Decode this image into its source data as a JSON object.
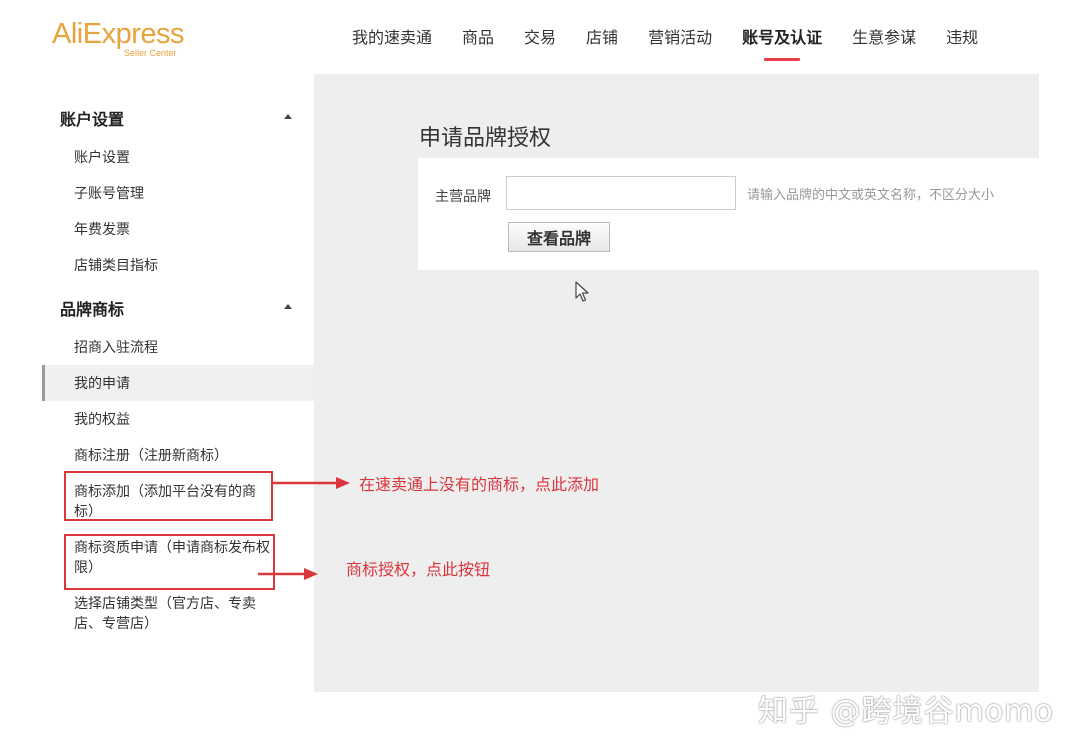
{
  "header": {
    "logo": {
      "main_ali": "Ali",
      "main_express": "Express",
      "sub": "Seller Center"
    },
    "nav": [
      {
        "label": "我的速卖通",
        "active": false
      },
      {
        "label": "商品",
        "active": false
      },
      {
        "label": "交易",
        "active": false
      },
      {
        "label": "店铺",
        "active": false
      },
      {
        "label": "营销活动",
        "active": false
      },
      {
        "label": "账号及认证",
        "active": true
      },
      {
        "label": "生意参谋",
        "active": false
      },
      {
        "label": "违规",
        "active": false
      }
    ]
  },
  "sidebar": {
    "groups": [
      {
        "title": "账户设置",
        "items": [
          "账户设置",
          "子账号管理",
          "年费发票",
          "店铺类目指标"
        ]
      },
      {
        "title": "品牌商标",
        "items": [
          "招商入驻流程",
          "我的申请",
          "我的权益",
          "商标注册（注册新商标）",
          "商标添加（添加平台没有的商标）",
          "商标资质申请（申请商标发布权限）",
          "选择店铺类型（官方店、专卖店、专营店）"
        ]
      }
    ],
    "active_item": "我的申请"
  },
  "main": {
    "title": "申请品牌授权",
    "form": {
      "label": "主营品牌",
      "input_value": "",
      "hint": "请输入品牌的中文或英文名称，不区分大小",
      "button": "查看品牌"
    }
  },
  "annotations": {
    "add_trademark": "在速卖通上没有的商标，点此添加",
    "authorize_trademark": "商标授权，点此按钮"
  },
  "watermark": "知乎 @跨境谷momo",
  "colors": {
    "brand": "#e8a33c",
    "active_underline": "#e8404b",
    "annotation": "#d9363e",
    "main_bg": "#eeeeee"
  }
}
